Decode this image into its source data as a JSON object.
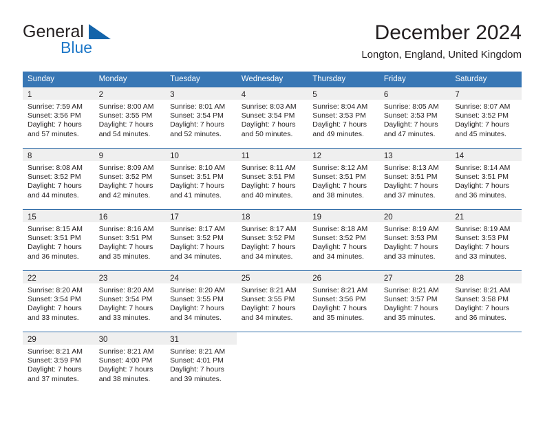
{
  "brand": {
    "name_part1": "General",
    "name_part2": "Blue",
    "logo_icon": "triangle-logo-icon",
    "accent_color": "#1e78c8",
    "logo_color": "#1464aa"
  },
  "header": {
    "title": "December 2024",
    "subtitle": "Longton, England, United Kingdom"
  },
  "theme": {
    "header_row_bg": "#3877b5",
    "week_divider": "#2f6ca8",
    "daynum_band_bg": "#efefef",
    "text_color": "#231f20"
  },
  "weekday_headers": [
    "Sunday",
    "Monday",
    "Tuesday",
    "Wednesday",
    "Thursday",
    "Friday",
    "Saturday"
  ],
  "weeks": [
    [
      {
        "day": "1",
        "sunrise": "Sunrise: 7:59 AM",
        "sunset": "Sunset: 3:56 PM",
        "daylight_line1": "Daylight: 7 hours",
        "daylight_line2": "and 57 minutes."
      },
      {
        "day": "2",
        "sunrise": "Sunrise: 8:00 AM",
        "sunset": "Sunset: 3:55 PM",
        "daylight_line1": "Daylight: 7 hours",
        "daylight_line2": "and 54 minutes."
      },
      {
        "day": "3",
        "sunrise": "Sunrise: 8:01 AM",
        "sunset": "Sunset: 3:54 PM",
        "daylight_line1": "Daylight: 7 hours",
        "daylight_line2": "and 52 minutes."
      },
      {
        "day": "4",
        "sunrise": "Sunrise: 8:03 AM",
        "sunset": "Sunset: 3:54 PM",
        "daylight_line1": "Daylight: 7 hours",
        "daylight_line2": "and 50 minutes."
      },
      {
        "day": "5",
        "sunrise": "Sunrise: 8:04 AM",
        "sunset": "Sunset: 3:53 PM",
        "daylight_line1": "Daylight: 7 hours",
        "daylight_line2": "and 49 minutes."
      },
      {
        "day": "6",
        "sunrise": "Sunrise: 8:05 AM",
        "sunset": "Sunset: 3:53 PM",
        "daylight_line1": "Daylight: 7 hours",
        "daylight_line2": "and 47 minutes."
      },
      {
        "day": "7",
        "sunrise": "Sunrise: 8:07 AM",
        "sunset": "Sunset: 3:52 PM",
        "daylight_line1": "Daylight: 7 hours",
        "daylight_line2": "and 45 minutes."
      }
    ],
    [
      {
        "day": "8",
        "sunrise": "Sunrise: 8:08 AM",
        "sunset": "Sunset: 3:52 PM",
        "daylight_line1": "Daylight: 7 hours",
        "daylight_line2": "and 44 minutes."
      },
      {
        "day": "9",
        "sunrise": "Sunrise: 8:09 AM",
        "sunset": "Sunset: 3:52 PM",
        "daylight_line1": "Daylight: 7 hours",
        "daylight_line2": "and 42 minutes."
      },
      {
        "day": "10",
        "sunrise": "Sunrise: 8:10 AM",
        "sunset": "Sunset: 3:51 PM",
        "daylight_line1": "Daylight: 7 hours",
        "daylight_line2": "and 41 minutes."
      },
      {
        "day": "11",
        "sunrise": "Sunrise: 8:11 AM",
        "sunset": "Sunset: 3:51 PM",
        "daylight_line1": "Daylight: 7 hours",
        "daylight_line2": "and 40 minutes."
      },
      {
        "day": "12",
        "sunrise": "Sunrise: 8:12 AM",
        "sunset": "Sunset: 3:51 PM",
        "daylight_line1": "Daylight: 7 hours",
        "daylight_line2": "and 38 minutes."
      },
      {
        "day": "13",
        "sunrise": "Sunrise: 8:13 AM",
        "sunset": "Sunset: 3:51 PM",
        "daylight_line1": "Daylight: 7 hours",
        "daylight_line2": "and 37 minutes."
      },
      {
        "day": "14",
        "sunrise": "Sunrise: 8:14 AM",
        "sunset": "Sunset: 3:51 PM",
        "daylight_line1": "Daylight: 7 hours",
        "daylight_line2": "and 36 minutes."
      }
    ],
    [
      {
        "day": "15",
        "sunrise": "Sunrise: 8:15 AM",
        "sunset": "Sunset: 3:51 PM",
        "daylight_line1": "Daylight: 7 hours",
        "daylight_line2": "and 36 minutes."
      },
      {
        "day": "16",
        "sunrise": "Sunrise: 8:16 AM",
        "sunset": "Sunset: 3:51 PM",
        "daylight_line1": "Daylight: 7 hours",
        "daylight_line2": "and 35 minutes."
      },
      {
        "day": "17",
        "sunrise": "Sunrise: 8:17 AM",
        "sunset": "Sunset: 3:52 PM",
        "daylight_line1": "Daylight: 7 hours",
        "daylight_line2": "and 34 minutes."
      },
      {
        "day": "18",
        "sunrise": "Sunrise: 8:17 AM",
        "sunset": "Sunset: 3:52 PM",
        "daylight_line1": "Daylight: 7 hours",
        "daylight_line2": "and 34 minutes."
      },
      {
        "day": "19",
        "sunrise": "Sunrise: 8:18 AM",
        "sunset": "Sunset: 3:52 PM",
        "daylight_line1": "Daylight: 7 hours",
        "daylight_line2": "and 34 minutes."
      },
      {
        "day": "20",
        "sunrise": "Sunrise: 8:19 AM",
        "sunset": "Sunset: 3:53 PM",
        "daylight_line1": "Daylight: 7 hours",
        "daylight_line2": "and 33 minutes."
      },
      {
        "day": "21",
        "sunrise": "Sunrise: 8:19 AM",
        "sunset": "Sunset: 3:53 PM",
        "daylight_line1": "Daylight: 7 hours",
        "daylight_line2": "and 33 minutes."
      }
    ],
    [
      {
        "day": "22",
        "sunrise": "Sunrise: 8:20 AM",
        "sunset": "Sunset: 3:54 PM",
        "daylight_line1": "Daylight: 7 hours",
        "daylight_line2": "and 33 minutes."
      },
      {
        "day": "23",
        "sunrise": "Sunrise: 8:20 AM",
        "sunset": "Sunset: 3:54 PM",
        "daylight_line1": "Daylight: 7 hours",
        "daylight_line2": "and 33 minutes."
      },
      {
        "day": "24",
        "sunrise": "Sunrise: 8:20 AM",
        "sunset": "Sunset: 3:55 PM",
        "daylight_line1": "Daylight: 7 hours",
        "daylight_line2": "and 34 minutes."
      },
      {
        "day": "25",
        "sunrise": "Sunrise: 8:21 AM",
        "sunset": "Sunset: 3:55 PM",
        "daylight_line1": "Daylight: 7 hours",
        "daylight_line2": "and 34 minutes."
      },
      {
        "day": "26",
        "sunrise": "Sunrise: 8:21 AM",
        "sunset": "Sunset: 3:56 PM",
        "daylight_line1": "Daylight: 7 hours",
        "daylight_line2": "and 35 minutes."
      },
      {
        "day": "27",
        "sunrise": "Sunrise: 8:21 AM",
        "sunset": "Sunset: 3:57 PM",
        "daylight_line1": "Daylight: 7 hours",
        "daylight_line2": "and 35 minutes."
      },
      {
        "day": "28",
        "sunrise": "Sunrise: 8:21 AM",
        "sunset": "Sunset: 3:58 PM",
        "daylight_line1": "Daylight: 7 hours",
        "daylight_line2": "and 36 minutes."
      }
    ],
    [
      {
        "day": "29",
        "sunrise": "Sunrise: 8:21 AM",
        "sunset": "Sunset: 3:59 PM",
        "daylight_line1": "Daylight: 7 hours",
        "daylight_line2": "and 37 minutes."
      },
      {
        "day": "30",
        "sunrise": "Sunrise: 8:21 AM",
        "sunset": "Sunset: 4:00 PM",
        "daylight_line1": "Daylight: 7 hours",
        "daylight_line2": "and 38 minutes."
      },
      {
        "day": "31",
        "sunrise": "Sunrise: 8:21 AM",
        "sunset": "Sunset: 4:01 PM",
        "daylight_line1": "Daylight: 7 hours",
        "daylight_line2": "and 39 minutes."
      },
      null,
      null,
      null,
      null
    ]
  ]
}
